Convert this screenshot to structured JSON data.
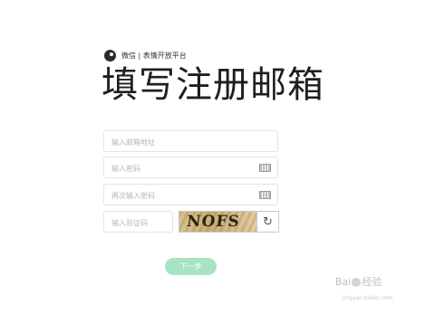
{
  "brand": {
    "text": "微信 | 表情开放平台"
  },
  "title": "填写注册邮箱",
  "form": {
    "email_placeholder": "输入邮箱地址",
    "password_placeholder": "输入密码",
    "confirm_password_placeholder": "再次输入密码",
    "captcha_placeholder": "输入验证码",
    "captcha_text": "NOFS"
  },
  "next_button": "下一步",
  "watermark": {
    "left": "Bai",
    "right": "经验",
    "sub": "jingyan.baidu.com"
  },
  "icons": {
    "brand": "wechat-logo-icon",
    "keyboard": "keyboard-icon",
    "refresh": "refresh-icon"
  },
  "colors": {
    "next_button_bg": "#a8e3c4",
    "title_text": "#1f1f1f"
  }
}
